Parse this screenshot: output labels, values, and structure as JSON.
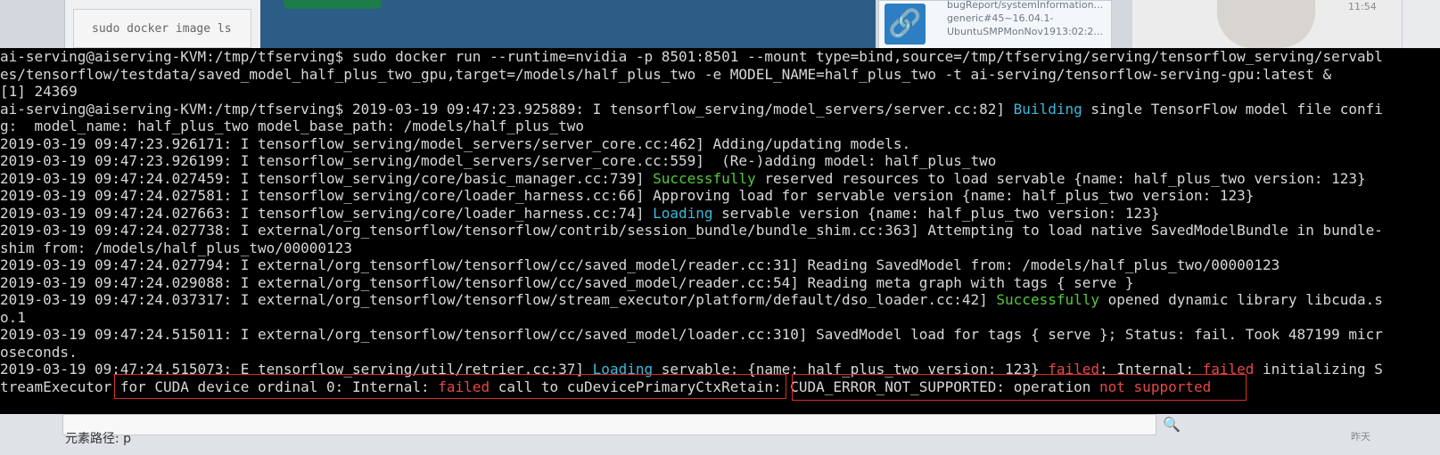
{
  "background": {
    "code_snippet": "sudo docker image ls",
    "card_text": [
      "bugReport/systemInformation...",
      "generic#45~16.04.1-",
      "UbuntuSMPMonNov1913:02:2..."
    ],
    "clock": "11:54",
    "bottom_label": "元素路径: p",
    "bottom_side": "昨天"
  },
  "terminal": {
    "lines": [
      {
        "segments": [
          {
            "text": "ai-serving@aiserving-KVM:/tmp/tfserving$ sudo docker run --runtime=nvidia -p 8501:8501 --mount type=bind,source=/tmp/tfserving/serving/tensorflow_serving/servabl"
          }
        ]
      },
      {
        "segments": [
          {
            "text": "es/tensorflow/testdata/saved_model_half_plus_two_gpu,target=/models/half_plus_two -e MODEL_NAME=half_plus_two -t ai-serving/tensorflow-serving-gpu:latest &"
          }
        ]
      },
      {
        "segments": [
          {
            "text": "[1] 24369"
          }
        ]
      },
      {
        "segments": [
          {
            "text": "ai-serving@aiserving-KVM:/tmp/tfserving$ 2019-03-19 09:47:23.925889: I tensorflow_serving/model_servers/server.cc:82] "
          },
          {
            "text": "Building",
            "style": "cyan"
          },
          {
            "text": " single TensorFlow model file confi"
          }
        ]
      },
      {
        "segments": [
          {
            "text": "g:  model_name: half_plus_two model_base_path: /models/half_plus_two"
          }
        ]
      },
      {
        "segments": [
          {
            "text": "2019-03-19 09:47:23.926171: I tensorflow_serving/model_servers/server_core.cc:462] Adding/updating models."
          }
        ]
      },
      {
        "segments": [
          {
            "text": "2019-03-19 09:47:23.926199: I tensorflow_serving/model_servers/server_core.cc:559]  (Re-)adding model: half_plus_two"
          }
        ]
      },
      {
        "segments": [
          {
            "text": "2019-03-19 09:47:24.027459: I tensorflow_serving/core/basic_manager.cc:739] "
          },
          {
            "text": "Successfully",
            "style": "green"
          },
          {
            "text": " reserved resources to load servable {name: half_plus_two version: 123}"
          }
        ]
      },
      {
        "segments": [
          {
            "text": "2019-03-19 09:47:24.027581: I tensorflow_serving/core/loader_harness.cc:66] Approving load for servable version {name: half_plus_two version: 123}"
          }
        ]
      },
      {
        "segments": [
          {
            "text": "2019-03-19 09:47:24.027663: I tensorflow_serving/core/loader_harness.cc:74] "
          },
          {
            "text": "Loading",
            "style": "cyan"
          },
          {
            "text": " servable version {name: half_plus_two version: 123}"
          }
        ]
      },
      {
        "segments": [
          {
            "text": "2019-03-19 09:47:24.027738: I external/org_tensorflow/tensorflow/contrib/session_bundle/bundle_shim.cc:363] Attempting to load native SavedModelBundle in bundle-"
          }
        ]
      },
      {
        "segments": [
          {
            "text": "shim from: /models/half_plus_two/00000123"
          }
        ]
      },
      {
        "segments": [
          {
            "text": "2019-03-19 09:47:24.027794: I external/org_tensorflow/tensorflow/cc/saved_model/reader.cc:31] Reading SavedModel from: /models/half_plus_two/00000123"
          }
        ]
      },
      {
        "segments": [
          {
            "text": "2019-03-19 09:47:24.029088: I external/org_tensorflow/tensorflow/cc/saved_model/reader.cc:54] Reading meta graph with tags { serve }"
          }
        ]
      },
      {
        "segments": [
          {
            "text": "2019-03-19 09:47:24.037317: I external/org_tensorflow/tensorflow/stream_executor/platform/default/dso_loader.cc:42] "
          },
          {
            "text": "Successfully",
            "style": "green"
          },
          {
            "text": " opened dynamic library libcuda.s"
          }
        ]
      },
      {
        "segments": [
          {
            "text": "o.1"
          }
        ]
      },
      {
        "segments": [
          {
            "text": "2019-03-19 09:47:24.515011: I external/org_tensorflow/tensorflow/cc/saved_model/loader.cc:310] SavedModel load for tags { serve }; Status: fail. Took 487199 micr"
          }
        ]
      },
      {
        "segments": [
          {
            "text": "oseconds."
          }
        ]
      },
      {
        "segments": [
          {
            "text": "2019-03-19 09:47:24.515073: E tensorflow_serving/util/retrier.cc:37] "
          },
          {
            "text": "Loading",
            "style": "cyan"
          },
          {
            "text": " servable: {name: half_plus_two version: 123} "
          },
          {
            "text": "failed",
            "style": "red"
          },
          {
            "text": ": Internal: "
          },
          {
            "text": "failed",
            "style": "red"
          },
          {
            "text": " initializing S"
          }
        ]
      },
      {
        "segments": [
          {
            "text": "treamExecutor "
          },
          {
            "text": "for CUDA device ordinal 0: Internal: "
          },
          {
            "text": "failed",
            "style": "red"
          },
          {
            "text": " call to cuDevicePrimaryCtxRetain: "
          },
          {
            "text": "CUDA_ERROR_NOT_SUPPORTED: operation "
          },
          {
            "text": "not supported",
            "style": "red"
          }
        ]
      }
    ]
  }
}
